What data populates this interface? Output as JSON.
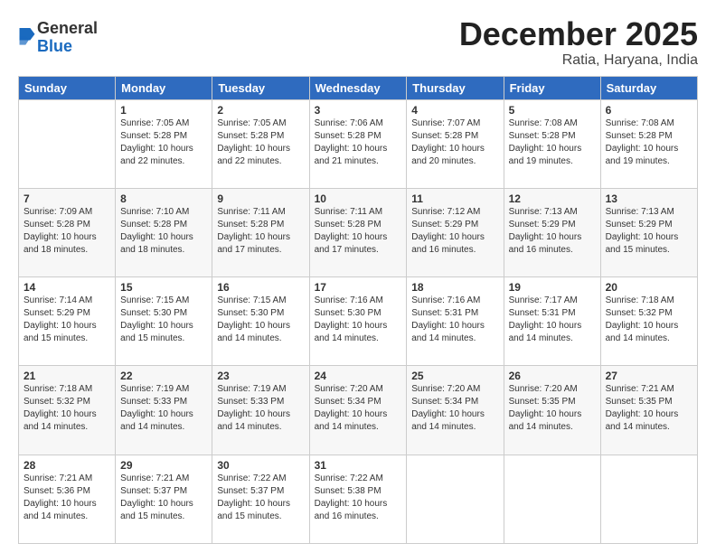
{
  "logo": {
    "general": "General",
    "blue": "Blue"
  },
  "header": {
    "month": "December 2025",
    "location": "Ratia, Haryana, India"
  },
  "weekdays": [
    "Sunday",
    "Monday",
    "Tuesday",
    "Wednesday",
    "Thursday",
    "Friday",
    "Saturday"
  ],
  "weeks": [
    [
      {
        "day": "",
        "sunrise": "",
        "sunset": "",
        "daylight": ""
      },
      {
        "day": "1",
        "sunrise": "7:05 AM",
        "sunset": "5:28 PM",
        "daylight": "10 hours and 22 minutes."
      },
      {
        "day": "2",
        "sunrise": "7:05 AM",
        "sunset": "5:28 PM",
        "daylight": "10 hours and 22 minutes."
      },
      {
        "day": "3",
        "sunrise": "7:06 AM",
        "sunset": "5:28 PM",
        "daylight": "10 hours and 21 minutes."
      },
      {
        "day": "4",
        "sunrise": "7:07 AM",
        "sunset": "5:28 PM",
        "daylight": "10 hours and 20 minutes."
      },
      {
        "day": "5",
        "sunrise": "7:08 AM",
        "sunset": "5:28 PM",
        "daylight": "10 hours and 19 minutes."
      },
      {
        "day": "6",
        "sunrise": "7:08 AM",
        "sunset": "5:28 PM",
        "daylight": "10 hours and 19 minutes."
      }
    ],
    [
      {
        "day": "7",
        "sunrise": "7:09 AM",
        "sunset": "5:28 PM",
        "daylight": "10 hours and 18 minutes."
      },
      {
        "day": "8",
        "sunrise": "7:10 AM",
        "sunset": "5:28 PM",
        "daylight": "10 hours and 18 minutes."
      },
      {
        "day": "9",
        "sunrise": "7:11 AM",
        "sunset": "5:28 PM",
        "daylight": "10 hours and 17 minutes."
      },
      {
        "day": "10",
        "sunrise": "7:11 AM",
        "sunset": "5:28 PM",
        "daylight": "10 hours and 17 minutes."
      },
      {
        "day": "11",
        "sunrise": "7:12 AM",
        "sunset": "5:29 PM",
        "daylight": "10 hours and 16 minutes."
      },
      {
        "day": "12",
        "sunrise": "7:13 AM",
        "sunset": "5:29 PM",
        "daylight": "10 hours and 16 minutes."
      },
      {
        "day": "13",
        "sunrise": "7:13 AM",
        "sunset": "5:29 PM",
        "daylight": "10 hours and 15 minutes."
      }
    ],
    [
      {
        "day": "14",
        "sunrise": "7:14 AM",
        "sunset": "5:29 PM",
        "daylight": "10 hours and 15 minutes."
      },
      {
        "day": "15",
        "sunrise": "7:15 AM",
        "sunset": "5:30 PM",
        "daylight": "10 hours and 15 minutes."
      },
      {
        "day": "16",
        "sunrise": "7:15 AM",
        "sunset": "5:30 PM",
        "daylight": "10 hours and 14 minutes."
      },
      {
        "day": "17",
        "sunrise": "7:16 AM",
        "sunset": "5:30 PM",
        "daylight": "10 hours and 14 minutes."
      },
      {
        "day": "18",
        "sunrise": "7:16 AM",
        "sunset": "5:31 PM",
        "daylight": "10 hours and 14 minutes."
      },
      {
        "day": "19",
        "sunrise": "7:17 AM",
        "sunset": "5:31 PM",
        "daylight": "10 hours and 14 minutes."
      },
      {
        "day": "20",
        "sunrise": "7:18 AM",
        "sunset": "5:32 PM",
        "daylight": "10 hours and 14 minutes."
      }
    ],
    [
      {
        "day": "21",
        "sunrise": "7:18 AM",
        "sunset": "5:32 PM",
        "daylight": "10 hours and 14 minutes."
      },
      {
        "day": "22",
        "sunrise": "7:19 AM",
        "sunset": "5:33 PM",
        "daylight": "10 hours and 14 minutes."
      },
      {
        "day": "23",
        "sunrise": "7:19 AM",
        "sunset": "5:33 PM",
        "daylight": "10 hours and 14 minutes."
      },
      {
        "day": "24",
        "sunrise": "7:20 AM",
        "sunset": "5:34 PM",
        "daylight": "10 hours and 14 minutes."
      },
      {
        "day": "25",
        "sunrise": "7:20 AM",
        "sunset": "5:34 PM",
        "daylight": "10 hours and 14 minutes."
      },
      {
        "day": "26",
        "sunrise": "7:20 AM",
        "sunset": "5:35 PM",
        "daylight": "10 hours and 14 minutes."
      },
      {
        "day": "27",
        "sunrise": "7:21 AM",
        "sunset": "5:35 PM",
        "daylight": "10 hours and 14 minutes."
      }
    ],
    [
      {
        "day": "28",
        "sunrise": "7:21 AM",
        "sunset": "5:36 PM",
        "daylight": "10 hours and 14 minutes."
      },
      {
        "day": "29",
        "sunrise": "7:21 AM",
        "sunset": "5:37 PM",
        "daylight": "10 hours and 15 minutes."
      },
      {
        "day": "30",
        "sunrise": "7:22 AM",
        "sunset": "5:37 PM",
        "daylight": "10 hours and 15 minutes."
      },
      {
        "day": "31",
        "sunrise": "7:22 AM",
        "sunset": "5:38 PM",
        "daylight": "10 hours and 16 minutes."
      },
      {
        "day": "",
        "sunrise": "",
        "sunset": "",
        "daylight": ""
      },
      {
        "day": "",
        "sunrise": "",
        "sunset": "",
        "daylight": ""
      },
      {
        "day": "",
        "sunrise": "",
        "sunset": "",
        "daylight": ""
      }
    ]
  ],
  "labels": {
    "sunrise": "Sunrise: ",
    "sunset": "Sunset: ",
    "daylight": "Daylight: "
  }
}
